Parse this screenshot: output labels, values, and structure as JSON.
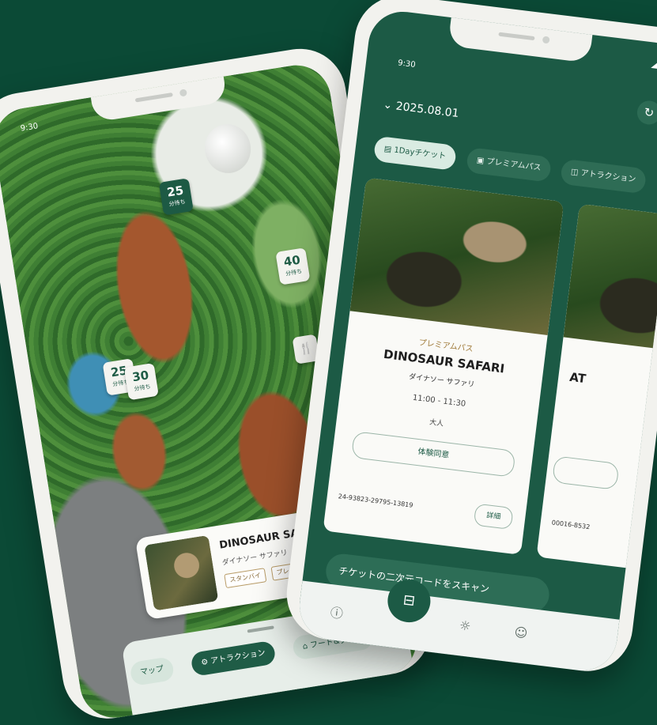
{
  "left_phone": {
    "time": "9:30",
    "wait_pins": [
      {
        "value": "25",
        "unit": "分待ち"
      },
      {
        "value": "40",
        "unit": "分待ち"
      },
      {
        "value": "25",
        "unit": "分待ち"
      },
      {
        "value": "30",
        "unit": "分待ち"
      }
    ],
    "card": {
      "title": "DINOSAUR SAFARI",
      "subtitle": "ダイナソー サファリ",
      "tags": [
        "スタンバイ",
        "プレミアムパス"
      ]
    },
    "chips": [
      "マップ",
      "アトラクション",
      "フード&グッズ"
    ]
  },
  "right_phone": {
    "time": "9:30",
    "date": "2025.08.01",
    "tabs": [
      "1Dayチケット",
      "プレミアムパス",
      "アトラクション"
    ],
    "ticket": {
      "category": "プレミアムパス",
      "title": "DINOSAUR SAFARI",
      "subtitle": "ダイナソー サファリ",
      "time": "11:00 - 11:30",
      "type": "大人",
      "agree_label": "体験同意",
      "code": "24-93823-29795-13819",
      "detail_label": "詳細"
    },
    "next_ticket": {
      "title": "AT",
      "code": "00016-8532"
    },
    "scan_label": "チケットの二次元コードをスキャン"
  }
}
